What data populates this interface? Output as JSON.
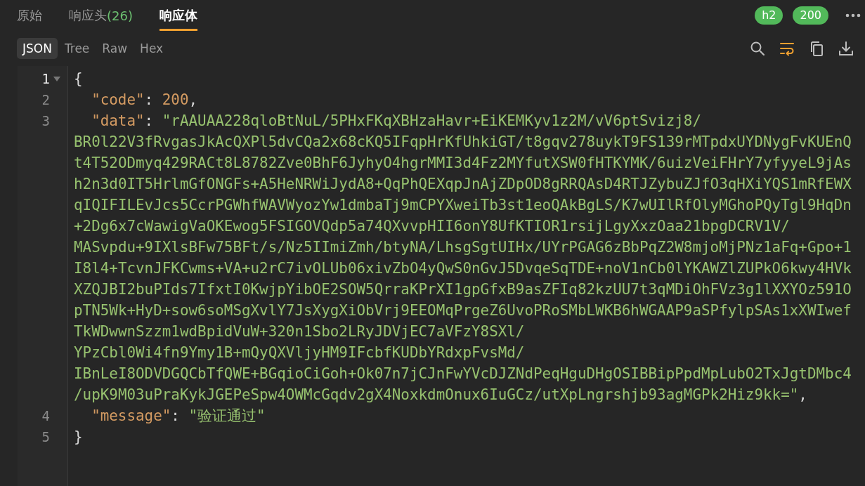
{
  "tabs": [
    {
      "label": "原始",
      "selected": false
    },
    {
      "label": "响应头",
      "count": "(26)",
      "selected": false
    },
    {
      "label": "响应体",
      "selected": true
    }
  ],
  "badges": [
    {
      "text": "h2"
    },
    {
      "text": "200"
    }
  ],
  "view_tabs": [
    {
      "label": "JSON",
      "selected": true
    },
    {
      "label": "Tree",
      "selected": false
    },
    {
      "label": "Raw",
      "selected": false
    },
    {
      "label": "Hex",
      "selected": false
    }
  ],
  "tools": [
    {
      "kind": "search",
      "on": false
    },
    {
      "kind": "wrap",
      "on": true
    },
    {
      "kind": "copy",
      "on": false
    },
    {
      "kind": "download",
      "on": false
    }
  ],
  "code_lines": [
    {
      "number": "1",
      "current": true,
      "foldable": true,
      "expanded": true,
      "indented": false,
      "tokens": [
        {
          "kind": "punct",
          "text": "{"
        }
      ]
    },
    {
      "number": "2",
      "current": false,
      "foldable": false,
      "indented": true,
      "tokens": [
        {
          "kind": "key",
          "text": "\"code\""
        },
        {
          "kind": "colon",
          "text": ":"
        },
        {
          "kind": "number",
          "text": "200"
        },
        {
          "kind": "punct",
          "text": ","
        }
      ]
    },
    {
      "number": "3",
      "current": false,
      "foldable": false,
      "indented": true,
      "tokens": [
        {
          "kind": "key",
          "text": "\"data\""
        },
        {
          "kind": "colon",
          "text": ":"
        },
        {
          "kind": "string",
          "text": "\"rAAUAA228qloBtNuL/5PHxFKqXBHzaHavr+EiKEMKyv1z2M/vV6ptSvizj8/"
        }
      ],
      "wrapped": [
        "BR0l22V3fRvgasJkAcQXPl5dvCQa2x68cKQ5IFqpHrKfUhkiGT/t8gqv278uykT9FS139rMTpdxUYDNygFvKUEnQ",
        "t4T52ODmyq429RACt8L8782Zve0BhF6JyhyO4hgrMMI3d4Fz2MYfutXSW0fHTKYMK/6uizVeiFHrY7yfyyeL9jAs",
        "h2n3d0IT5HrlmGfONGFs+A5HeNRWiJydA8+QqPhQEXqpJnAjZDpOD8gRRQAsD4RTJZybuZJfO3qHXiYQS1mRfEWX",
        "qIQIFILEvJcs5CcrPGWhfWAVWyozYw1dmbaTj9mCPYXweiTb3st1eoQAkBgLS/K7wUIlRfOlyMGhoPQyTgl9HqDn",
        "+2Dg6x7cWawigVaOKEwog5FSIGOVQdp5a74QXvvpHII6onY8UfKTIOR1rsijLgyXxzOaa21bpgDCRV1V/",
        "MASvpdu+9IXlsBFw75BFt/s/Nz5IImiZmh/btyNA/LhsgSgtUIHx/UYrPGAG6zBbPqZ2W8mjoMjPNz1aFq+Gpo+1",
        "I8l4+TcvnJFKCwms+VA+u2rC7ivOLUb06xivZbO4yQwS0nGvJ5DvqeSqTDE+noV1nCb0lYKAWZlZUPkO6kwy4HVk",
        "XZQJBI2buPIds7IfxtI0KwjpYibOE2SOW5QrraKPrXI1gpGfxB9asZFIq82kzUU7t3qMDiOhFVz3g1lXXYOz591O",
        "pTN5Wk+HyD+sow6soMSgXvlY7JsXygXiObVrj9EEOMqPrgeZ6UvoPRoSMbLWKB6hWGAAP9aSPfylpSAs1xXWIwef",
        "TkWDwwnSzzm1wdBpidVuW+320n1Sbo2LRyJDVjEC7aVFzY8SXl/",
        "YPzCbl0Wi4fn9Ymy1B+mQyQXVljyHM9IFcbfKUDbYRdxpFvsMd/",
        "IBnLeI8ODVDGQCbTfQWE+BGqioCiGoh+Ok07n7jCJnFwYVcDJZNdPeqHguDHgOSIBBipPpdMpLubO2TxJgtDMbc4",
        "/upK9M03uPraKykJGEPeSpw4OWMcGqdv2gX4NoxkdmOnux6IuGCz/utXpLngrshjb93agMGPk2Hiz9kk=\""
      ],
      "wrapped_end": ","
    },
    {
      "number": "4",
      "current": false,
      "foldable": false,
      "indented": true,
      "tokens": [
        {
          "kind": "key",
          "text": "\"message\""
        },
        {
          "kind": "colon",
          "text": ":"
        },
        {
          "kind": "string",
          "text": "\"验证通过\""
        }
      ]
    },
    {
      "number": "5",
      "current": false,
      "foldable": false,
      "indented": false,
      "tokens": [
        {
          "kind": "punct",
          "text": "}"
        }
      ]
    }
  ]
}
